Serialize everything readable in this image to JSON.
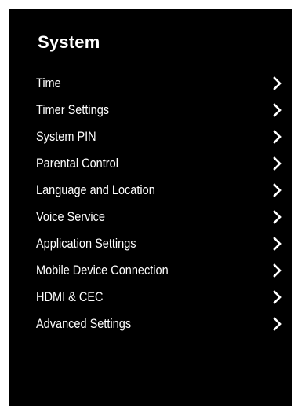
{
  "page": {
    "title": "System"
  },
  "menu": {
    "items": [
      {
        "label": "Time",
        "icon": "chevron-right-icon"
      },
      {
        "label": "Timer Settings",
        "icon": "chevron-right-icon"
      },
      {
        "label": "System PIN",
        "icon": "chevron-right-icon"
      },
      {
        "label": "Parental Control",
        "icon": "chevron-right-icon"
      },
      {
        "label": "Language and Location",
        "icon": "chevron-right-icon"
      },
      {
        "label": "Voice Service",
        "icon": "chevron-right-icon"
      },
      {
        "label": "Application Settings",
        "icon": "chevron-right-icon"
      },
      {
        "label": "Mobile Device Connection",
        "icon": "chevron-right-icon"
      },
      {
        "label": "HDMI & CEC",
        "icon": "chevron-right-icon"
      },
      {
        "label": "Advanced Settings",
        "icon": "chevron-right-icon"
      }
    ]
  },
  "colors": {
    "background": "#000000",
    "text": "#ffffff",
    "page": "#ffffff"
  }
}
